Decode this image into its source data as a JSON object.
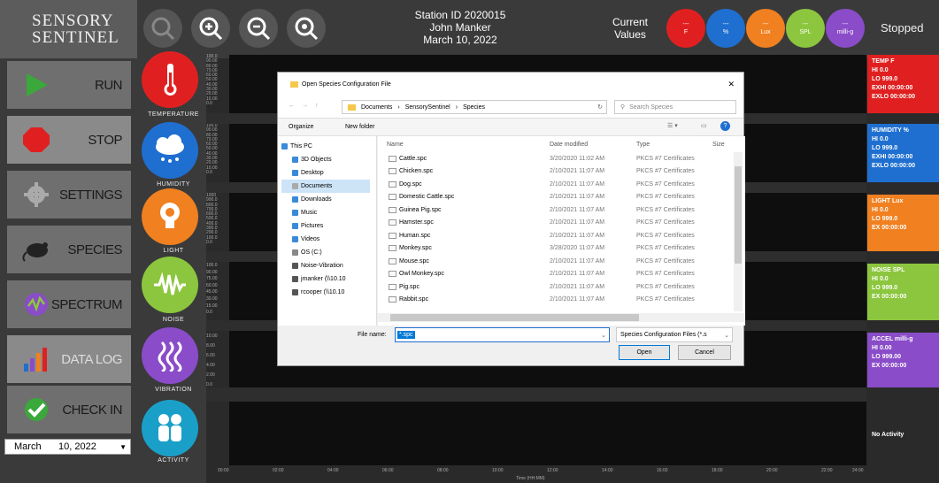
{
  "logo": {
    "line1": "SENSORY",
    "line2": "SENTINEL"
  },
  "toolbar": {
    "icons": [
      "search-icon",
      "zoom-in-icon",
      "zoom-out-icon",
      "zoom-reset-icon"
    ]
  },
  "station": {
    "id": "Station ID 2020015",
    "name": "John Manker",
    "date": "March 10, 2022"
  },
  "current_values": {
    "label_line1": "Current",
    "label_line2": "Values"
  },
  "value_badges": [
    {
      "value": "---",
      "unit": "F",
      "color": "#e02020"
    },
    {
      "value": "---",
      "unit": "%",
      "color": "#1f6fd0"
    },
    {
      "value": "---",
      "unit": "Lux",
      "color": "#f08020"
    },
    {
      "value": "---",
      "unit": "SPL",
      "color": "#8cc63e"
    },
    {
      "value": "---",
      "unit": "milli-g",
      "color": "#8a4cc8"
    }
  ],
  "status": "Stopped",
  "menu": [
    {
      "label": "RUN"
    },
    {
      "label": "STOP"
    },
    {
      "label": "SETTINGS"
    },
    {
      "label": "SPECIES"
    },
    {
      "label": "SPECTRUM"
    },
    {
      "label": "DATA LOG"
    },
    {
      "label": "CHECK IN"
    }
  ],
  "date_select": {
    "month": "March",
    "day_year": "10, 2022"
  },
  "sensors": [
    {
      "label": "TEMPERATURE",
      "color": "#e02020"
    },
    {
      "label": "HUMIDITY",
      "color": "#1f6fd0"
    },
    {
      "label": "LIGHT",
      "color": "#f08020"
    },
    {
      "label": "NOISE",
      "color": "#8cc63e"
    },
    {
      "label": "VIBRATION",
      "color": "#8a4cc8"
    },
    {
      "label": "ACTIVITY",
      "color": "#1aa0c8"
    }
  ],
  "axes": {
    "temperature": [
      "100.0",
      "90.00",
      "80.00",
      "70.00",
      "60.00",
      "50.00",
      "40.00",
      "30.00",
      "20.00",
      "10.00",
      "0.0"
    ],
    "humidity": [
      "100.0",
      "90.00",
      "80.00",
      "70.00",
      "60.00",
      "50.00",
      "40.00",
      "30.00",
      "20.00",
      "10.00",
      "0.0"
    ],
    "light": [
      "1000",
      "900.0",
      "800.0",
      "700.0",
      "600.0",
      "500.0",
      "400.0",
      "300.0",
      "200.0",
      "100.0",
      "0.0"
    ],
    "noise": [
      "100.0",
      "90.00",
      "75.00",
      "60.00",
      "45.00",
      "30.00",
      "15.00",
      "0.0"
    ],
    "vibration": [
      "10.00",
      "8.00",
      "6.00",
      "4.00",
      "2.00",
      "0.0"
    ]
  },
  "x_ticks": [
    "00:00",
    "02:00",
    "04:00",
    "06:00",
    "08:00",
    "10:00",
    "12:00",
    "14:00",
    "16:00",
    "18:00",
    "20:00",
    "22:00",
    "24:00"
  ],
  "x_label": "Time (HH:MM)",
  "right_panels": {
    "temp": {
      "title": "TEMP F",
      "lines": [
        "HI 0.0",
        "LO 999.0",
        "EXHI 00:00:00",
        "EXLO 00:00:00"
      ],
      "color": "#e02020"
    },
    "humidity": {
      "title": "HUMIDITY %",
      "lines": [
        "HI 0.0",
        "LO 999.0",
        "EXHI 00:00:00",
        "EXLO 00:00:00"
      ],
      "color": "#1f6fd0"
    },
    "light": {
      "title": "LIGHT Lux",
      "lines": [
        "HI 0.0",
        "LO 999.0",
        "EX 00:00:00"
      ],
      "color": "#f08020"
    },
    "noise": {
      "title": "NOISE SPL",
      "lines": [
        "HI 0.0",
        "LO 999.0",
        "EX 00:00:00"
      ],
      "color": "#8cc63e"
    },
    "accel": {
      "title": "ACCEL milli-g",
      "lines": [
        "HI 0.00",
        "LO 999.00",
        "EX 00:00:00"
      ],
      "color": "#8a4cc8"
    },
    "activity": {
      "title": "No Activity"
    }
  },
  "dialog": {
    "title": "Open Species Configuration File",
    "breadcrumb": [
      "Documents",
      "SensorySentinel",
      "Species"
    ],
    "search_placeholder": "Search Species",
    "organize": "Organize",
    "new_folder": "New folder",
    "columns": [
      "Name",
      "Date modified",
      "Type",
      "Size"
    ],
    "tree": [
      "This PC",
      "3D Objects",
      "Desktop",
      "Documents",
      "Downloads",
      "Music",
      "Pictures",
      "Videos",
      "OS (C:)",
      "Noise-Vibration",
      "jmanker (\\\\10.10",
      "rcooper (\\\\10.10"
    ],
    "files": [
      {
        "name": "Cattle.spc",
        "date": "3/20/2020 11:02 AM",
        "type": "PKCS #7 Certificates"
      },
      {
        "name": "Chicken.spc",
        "date": "2/10/2021 11:07 AM",
        "type": "PKCS #7 Certificates"
      },
      {
        "name": "Dog.spc",
        "date": "2/10/2021 11:07 AM",
        "type": "PKCS #7 Certificates"
      },
      {
        "name": "Domestic Cattle.spc",
        "date": "2/10/2021 11:07 AM",
        "type": "PKCS #7 Certificates"
      },
      {
        "name": "Guinea Pig.spc",
        "date": "2/10/2021 11:07 AM",
        "type": "PKCS #7 Certificates"
      },
      {
        "name": "Hamster.spc",
        "date": "2/10/2021 11:07 AM",
        "type": "PKCS #7 Certificates"
      },
      {
        "name": "Human.spc",
        "date": "2/10/2021 11:07 AM",
        "type": "PKCS #7 Certificates"
      },
      {
        "name": "Monkey.spc",
        "date": "3/28/2020 11:07 AM",
        "type": "PKCS #7 Certificates"
      },
      {
        "name": "Mouse.spc",
        "date": "2/10/2021 11:07 AM",
        "type": "PKCS #7 Certificates"
      },
      {
        "name": "Owl Monkey.spc",
        "date": "2/10/2021 11:07 AM",
        "type": "PKCS #7 Certificates"
      },
      {
        "name": "Pig.spc",
        "date": "2/10/2021 11:07 AM",
        "type": "PKCS #7 Certificates"
      },
      {
        "name": "Rabbit.spc",
        "date": "2/10/2021 11:07 AM",
        "type": "PKCS #7 Certificates"
      }
    ],
    "filename_label": "File name:",
    "filename_value": "*.spc",
    "filetype": "Species Configuration Files (*.s",
    "open": "Open",
    "cancel": "Cancel"
  }
}
